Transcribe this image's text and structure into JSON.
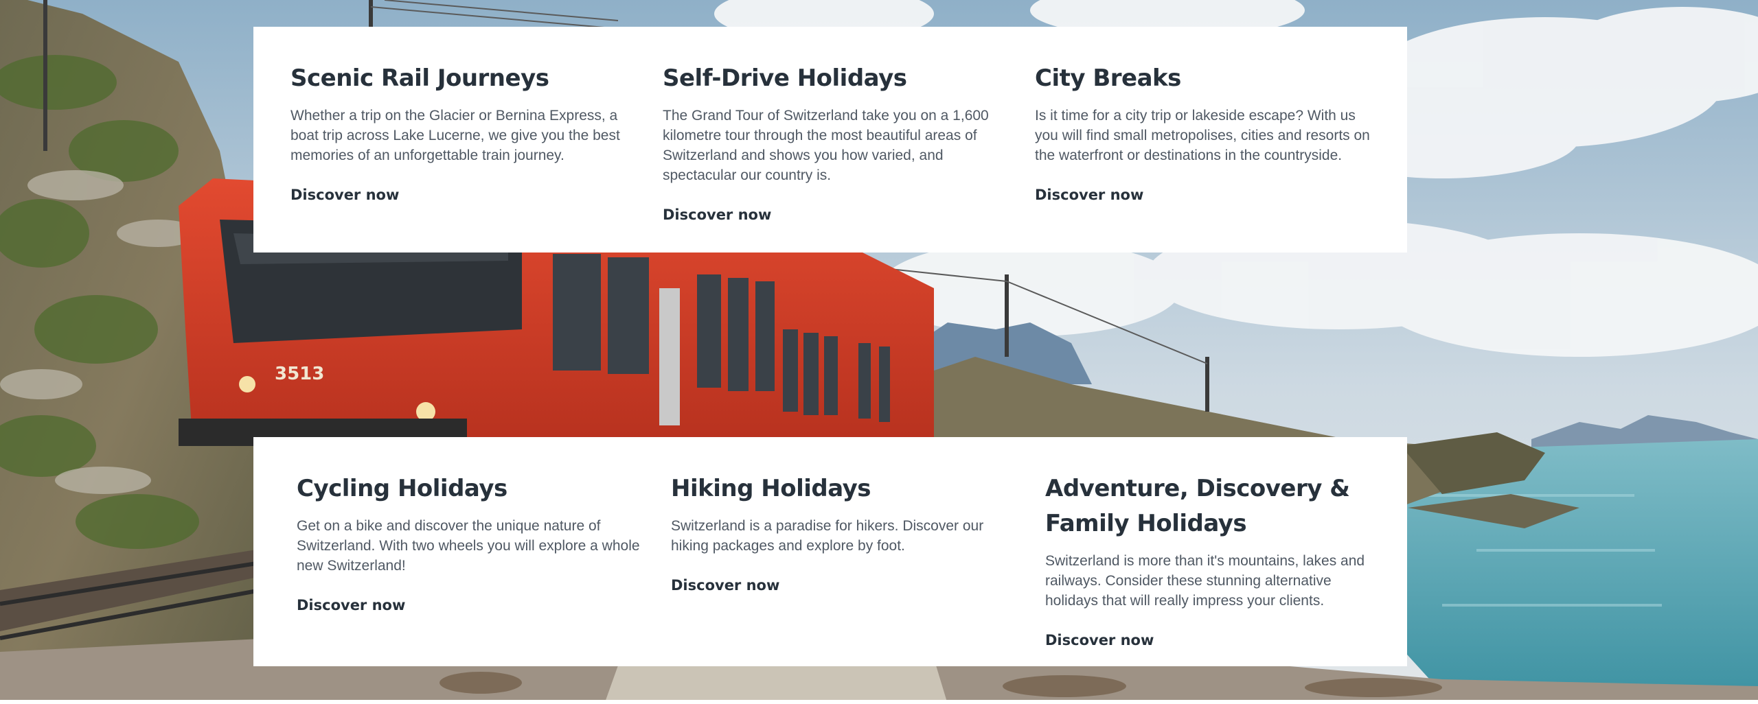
{
  "colors": {
    "panel_background": "#ffffff",
    "heading_text": "#27313b",
    "body_text": "#4f5863",
    "train_red": "#d2402a",
    "lake": "#5aa7b4",
    "sky": "#b9cbd9"
  },
  "background": {
    "icon": "scenic-train-lake-illustration",
    "train_number": "3513"
  },
  "top_cards": [
    {
      "title": "Scenic Rail Journeys",
      "description": "Whether a trip on the Glacier or Bernina Express, a boat trip across Lake Lucerne, we give you the best memories of an unforgettable train journey.",
      "link": "Discover now"
    },
    {
      "title": "Self-Drive Holidays",
      "description": "The Grand Tour of Switzerland take you on a 1,600 kilometre tour through the most beautiful areas of Switzerland and shows you how varied, and spectacular our country is.",
      "link": "Discover now"
    },
    {
      "title": "City Breaks",
      "description": "Is it time for a city trip or lakeside escape? With us you will find small metropolises, cities and resorts on the waterfront or destinations in the countryside.",
      "link": "Discover now"
    }
  ],
  "bottom_cards": [
    {
      "title": "Cycling Holidays",
      "description": "Get on a bike and discover the unique nature of Switzerland. With two wheels you will explore a whole new Switzerland!",
      "link": "Discover now"
    },
    {
      "title": "Hiking Holidays",
      "description": "Switzerland is a paradise for hikers. Discover our hiking packages and explore by foot.",
      "link": "Discover now"
    },
    {
      "title": "Adventure, Discovery & Family Holidays",
      "description": "Switzerland is more than it's mountains, lakes and railways. Consider these stunning alternative holidays that will really impress your clients.",
      "link": "Discover now"
    }
  ]
}
